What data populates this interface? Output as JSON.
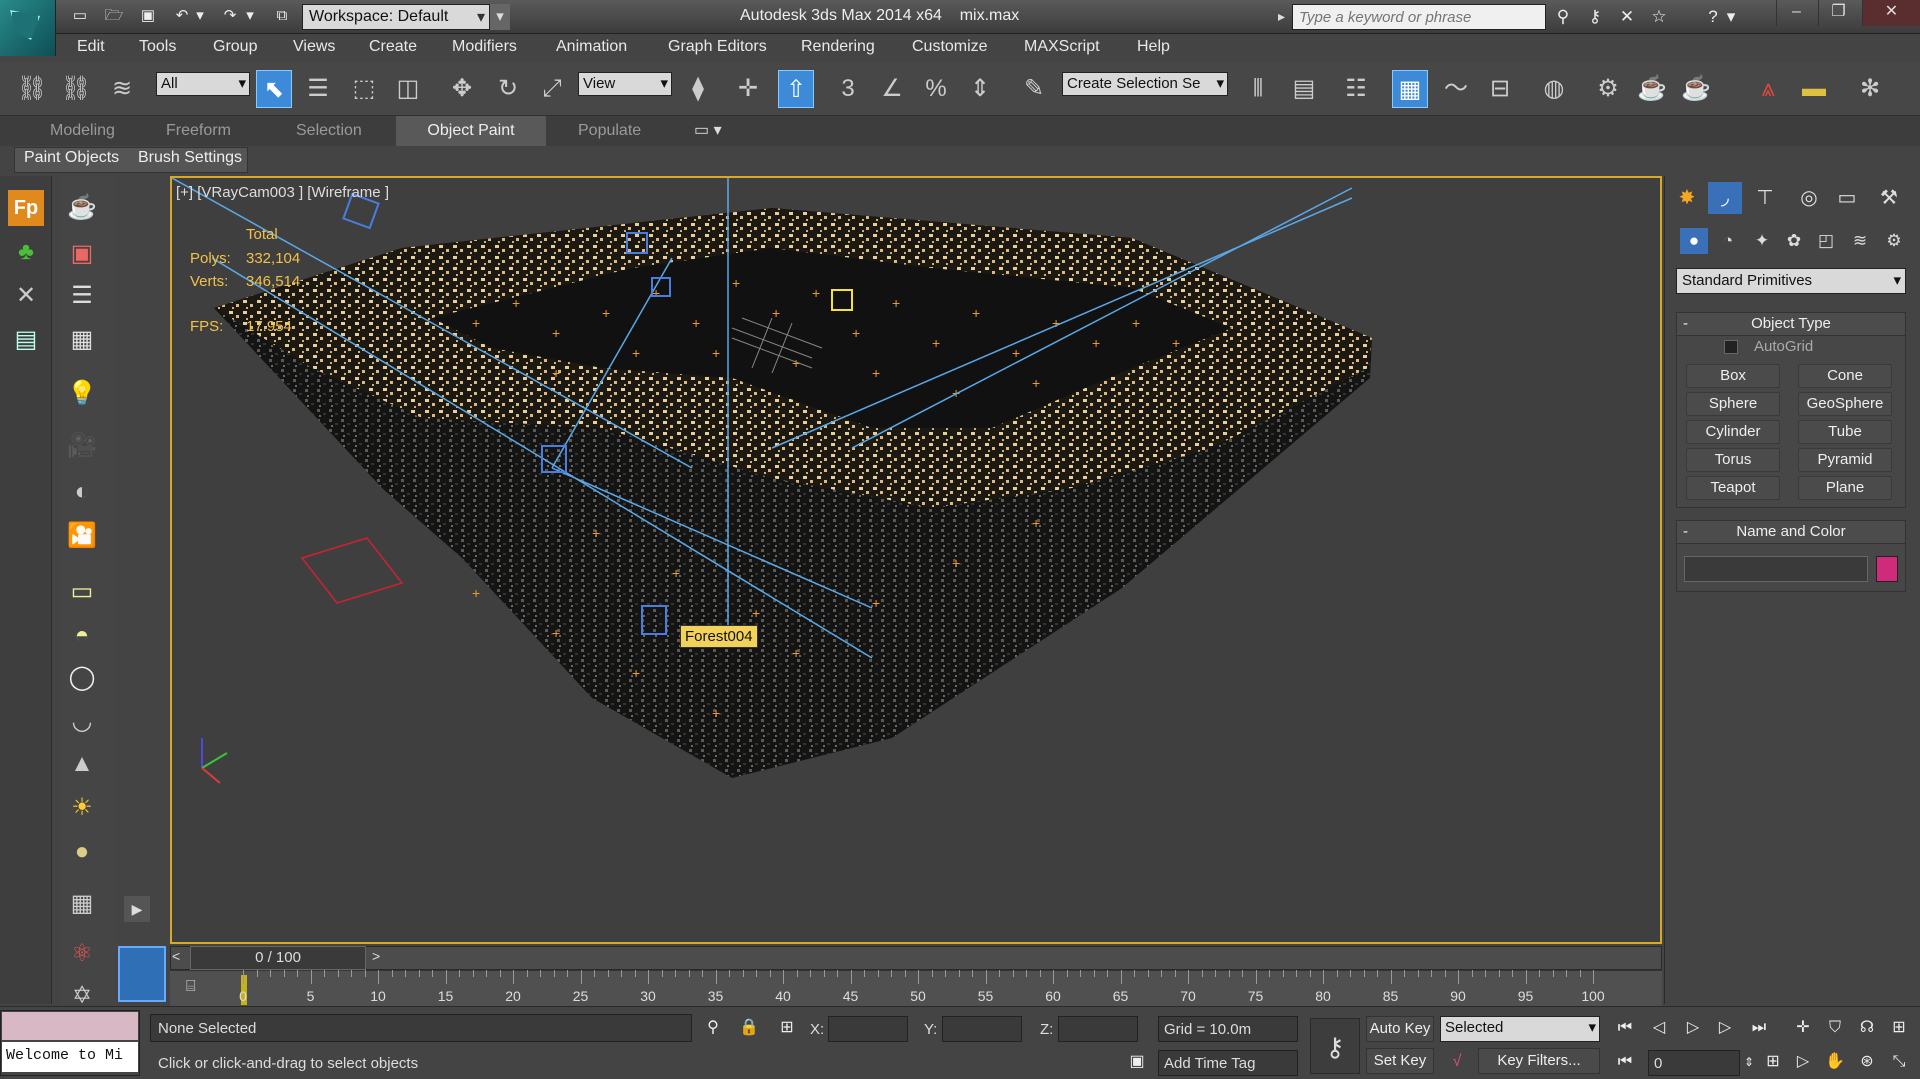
{
  "titlebar": {
    "workspace_label": "Workspace: Default",
    "app_title": "Autodesk 3ds Max  2014 x64",
    "file_name": "mix.max",
    "search_placeholder": "Type a keyword or phrase"
  },
  "menu": [
    "Edit",
    "Tools",
    "Group",
    "Views",
    "Create",
    "Modifiers",
    "Animation",
    "Graph Editors",
    "Rendering",
    "Customize",
    "MAXScript",
    "Help"
  ],
  "toolbar": {
    "selection_filter": "All",
    "ref_coord": "View",
    "named_selection": "Create Selection Se",
    "snap_label": "3"
  },
  "ribbon": {
    "tabs": [
      "Modeling",
      "Freeform",
      "Selection",
      "Object Paint",
      "Populate"
    ],
    "active_tab": "Object Paint",
    "subtabs": [
      "Paint Objects",
      "Brush Settings"
    ]
  },
  "viewport": {
    "label": "[+] [VRayCam003 ] [Wireframe ]",
    "stats": {
      "header": "Total",
      "polys_label": "Polys:",
      "polys_value": "332,104",
      "verts_label": "Verts:",
      "verts_value": "346,514",
      "fps_label": "FPS:",
      "fps_value": "17.954"
    },
    "tooltip": "Forest004"
  },
  "command_panel": {
    "category": "Standard Primitives",
    "object_type_title": "Object Type",
    "autogrid_label": "AutoGrid",
    "primitives": [
      "Box",
      "Cone",
      "Sphere",
      "GeoSphere",
      "Cylinder",
      "Tube",
      "Torus",
      "Pyramid",
      "Teapot",
      "Plane"
    ],
    "name_color_title": "Name and Color",
    "object_color": "#d02a7a"
  },
  "timeline": {
    "slider_label": "0 / 100",
    "tick_labels": [
      "0",
      "5",
      "10",
      "15",
      "20",
      "25",
      "30",
      "35",
      "40",
      "45",
      "50",
      "55",
      "60",
      "65",
      "70",
      "75",
      "80",
      "85",
      "90",
      "95",
      "100"
    ]
  },
  "status": {
    "maxscript_text": "Welcome to Mi",
    "selection": "None Selected",
    "prompt": "Click or click-and-drag to select objects",
    "x_label": "X:",
    "y_label": "Y:",
    "z_label": "Z:",
    "grid": "Grid = 10.0m",
    "add_time_tag": "Add Time Tag",
    "auto_key": "Auto Key",
    "set_key": "Set Key",
    "key_mode": "Selected",
    "key_filters": "Key Filters...",
    "current_frame": "0"
  }
}
